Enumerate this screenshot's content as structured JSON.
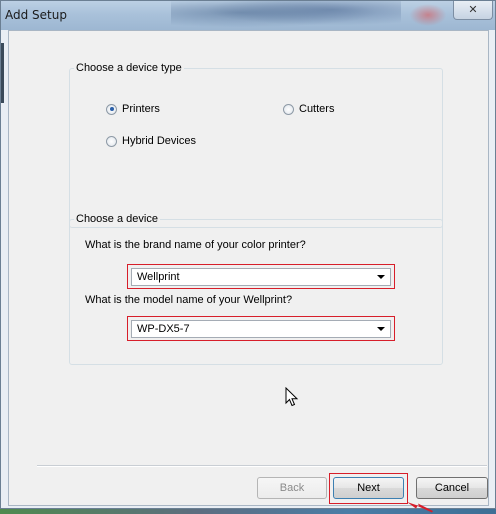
{
  "window": {
    "title": "Add Setup",
    "close_glyph": "✕"
  },
  "device_type": {
    "legend": "Choose a device type",
    "options": [
      {
        "label": "Printers",
        "selected": true
      },
      {
        "label": "Cutters",
        "selected": false
      },
      {
        "label": "Hybrid Devices",
        "selected": false
      }
    ]
  },
  "device": {
    "legend": "Choose a device",
    "brand_question": "What is the brand name of your color printer?",
    "brand_value": "Wellprint",
    "model_question": "What is the model name of your Wellprint?",
    "model_value": "WP-DX5-7"
  },
  "buttons": {
    "back": "Back",
    "next": "Next",
    "cancel": "Cancel"
  },
  "colors": {
    "highlight": "#d71e2a",
    "radio_selected": "#2b5fa8"
  }
}
